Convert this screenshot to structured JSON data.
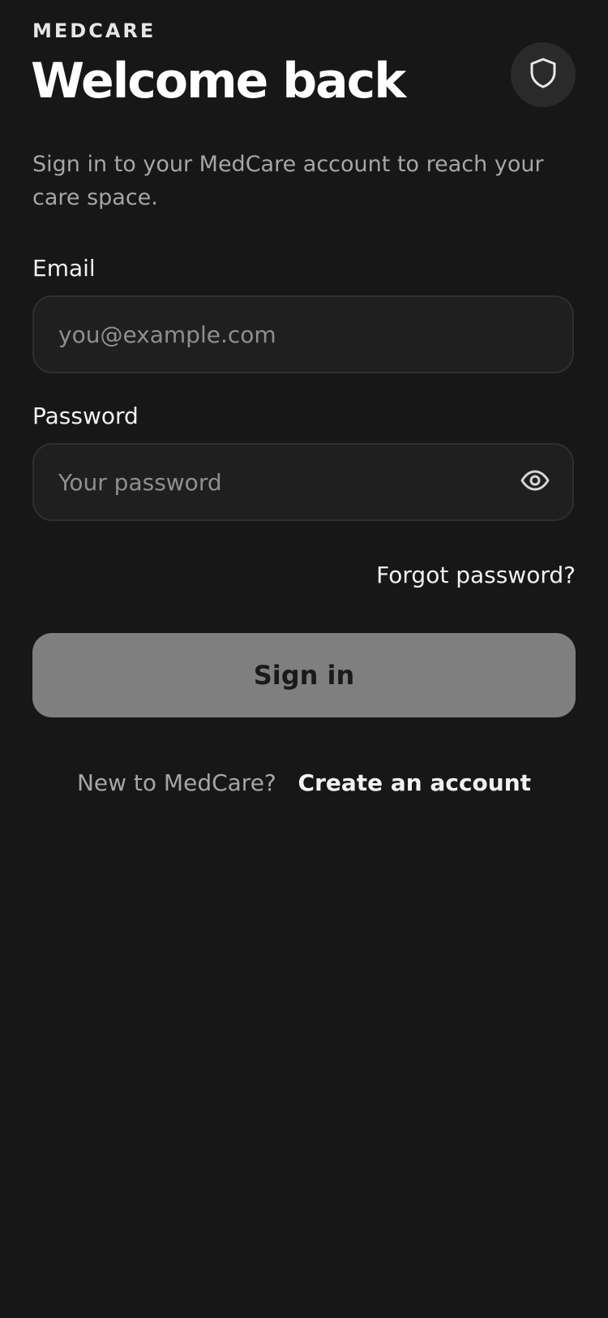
{
  "app": {
    "brand": "MEDCARE",
    "title": "Welcome back",
    "subtitle": "Sign in to your MedCare account to reach your care space."
  },
  "header": {
    "shield_icon": "shield-icon"
  },
  "form": {
    "email": {
      "label": "Email",
      "placeholder": "you@example.com",
      "value": ""
    },
    "password": {
      "label": "Password",
      "placeholder": "Your password",
      "value": "",
      "toggle_icon": "eye-icon"
    },
    "forgot_label": "Forgot password?",
    "submit_label": "Sign in"
  },
  "signup": {
    "prompt": "New to MedCare?",
    "link_label": "Create an account"
  },
  "colors": {
    "background": "#171717",
    "field_background": "#1f1f1f",
    "field_border": "#2f2f2f",
    "button_disabled": "#7f7f80",
    "muted_text": "#a6a6a6"
  }
}
